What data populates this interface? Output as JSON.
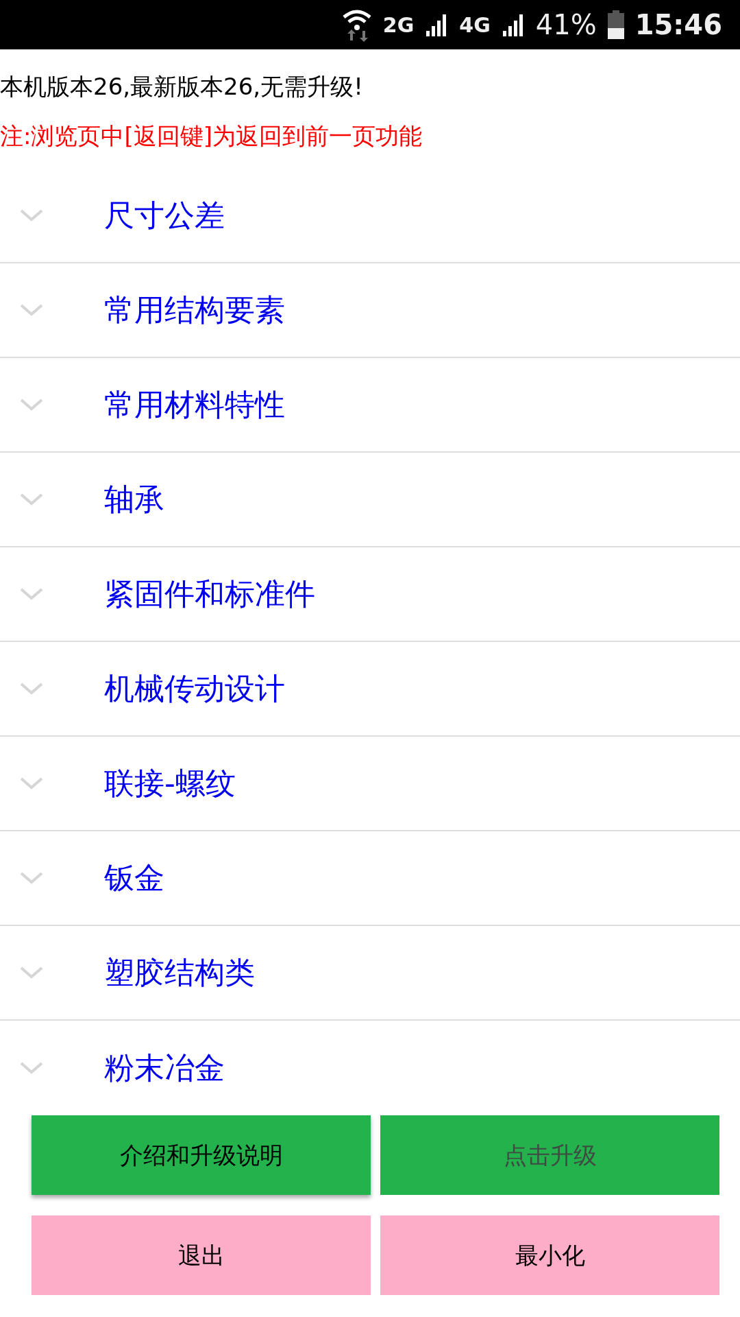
{
  "status_bar": {
    "network_1": "2G",
    "network_2": "4G",
    "battery": "41%",
    "time": "15:46"
  },
  "version_message": "本机版本26,最新版本26,无需升级!",
  "note": "注:浏览页中[返回键]为返回到前一页功能",
  "categories": [
    {
      "label": "尺寸公差",
      "expanded": false
    },
    {
      "label": "常用结构要素",
      "expanded": false
    },
    {
      "label": "常用材料特性",
      "expanded": false
    },
    {
      "label": "轴承",
      "expanded": false
    },
    {
      "label": "紧固件和标准件",
      "expanded": false
    },
    {
      "label": "机械传动设计",
      "expanded": false
    },
    {
      "label": "联接-螺纹",
      "expanded": false
    },
    {
      "label": "钣金",
      "expanded": false
    },
    {
      "label": "塑胶结构类",
      "expanded": false
    },
    {
      "label": "粉末冶金",
      "expanded": false
    }
  ],
  "buttons": [
    {
      "label": "介绍和升级说明",
      "kind": "green",
      "disabled": false
    },
    {
      "label": "点击升级",
      "kind": "green",
      "disabled": true
    },
    {
      "label": "退出",
      "kind": "pink",
      "disabled": false
    },
    {
      "label": "最小化",
      "kind": "pink",
      "disabled": false
    }
  ]
}
